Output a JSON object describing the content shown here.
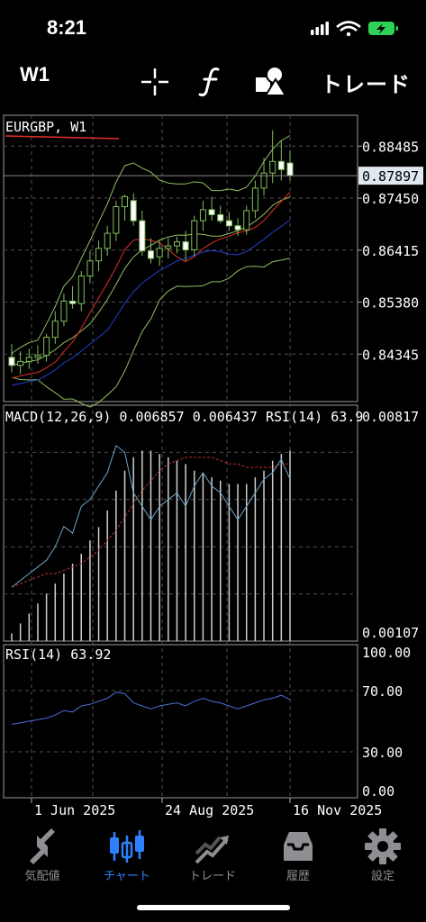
{
  "status": {
    "time": "8:21"
  },
  "toolbar": {
    "timeframe": "W1",
    "trade_label": "トレード"
  },
  "chart": {
    "symbol_label": "EURGBP, W1",
    "price_axis": [
      "0.88485",
      "0.87450",
      "0.86415",
      "0.85380",
      "0.84345"
    ],
    "current_price": "0.87897",
    "macd_label": "MACD(12,26,9) 0.006857 0.006437 RSI(14) 63.9",
    "macd_axis_top": "0.00817",
    "macd_axis_bottom": "0.00107",
    "rsi_label": "RSI(14) 63.92",
    "rsi_axis": [
      "100.00",
      "70.00",
      "30.00",
      "0.00"
    ],
    "time_axis": [
      "1 Jun 2025",
      "24 Aug 2025",
      "16 Nov 2025"
    ]
  },
  "chart_data": {
    "type": "candlestick",
    "symbol": "EURGBP",
    "timeframe": "W1",
    "current_price": 0.87897,
    "price_ylim": [
      0.834,
      0.891
    ],
    "price_ticks": [
      0.88485,
      0.8745,
      0.86415,
      0.8538,
      0.84345
    ],
    "x_labels": [
      "1 Jun 2025",
      "24 Aug 2025",
      "16 Nov 2025"
    ],
    "candles": [
      {
        "o": 0.8428,
        "h": 0.8455,
        "l": 0.8398,
        "c": 0.8412
      },
      {
        "o": 0.8412,
        "h": 0.844,
        "l": 0.8395,
        "c": 0.842
      },
      {
        "o": 0.842,
        "h": 0.8445,
        "l": 0.8405,
        "c": 0.8428
      },
      {
        "o": 0.8428,
        "h": 0.8452,
        "l": 0.8415,
        "c": 0.8432
      },
      {
        "o": 0.8432,
        "h": 0.8475,
        "l": 0.842,
        "c": 0.8468
      },
      {
        "o": 0.8468,
        "h": 0.852,
        "l": 0.8455,
        "c": 0.85
      },
      {
        "o": 0.85,
        "h": 0.8555,
        "l": 0.849,
        "c": 0.854
      },
      {
        "o": 0.854,
        "h": 0.857,
        "l": 0.8525,
        "c": 0.8535
      },
      {
        "o": 0.8535,
        "h": 0.86,
        "l": 0.852,
        "c": 0.859
      },
      {
        "o": 0.859,
        "h": 0.864,
        "l": 0.8575,
        "c": 0.862
      },
      {
        "o": 0.862,
        "h": 0.866,
        "l": 0.86,
        "c": 0.8645
      },
      {
        "o": 0.8645,
        "h": 0.869,
        "l": 0.863,
        "c": 0.8675
      },
      {
        "o": 0.8675,
        "h": 0.874,
        "l": 0.866,
        "c": 0.8728
      },
      {
        "o": 0.8728,
        "h": 0.8752,
        "l": 0.87,
        "c": 0.8748
      },
      {
        "o": 0.874,
        "h": 0.8755,
        "l": 0.869,
        "c": 0.87
      },
      {
        "o": 0.87,
        "h": 0.872,
        "l": 0.863,
        "c": 0.864
      },
      {
        "o": 0.864,
        "h": 0.8665,
        "l": 0.8615,
        "c": 0.8625
      },
      {
        "o": 0.8628,
        "h": 0.866,
        "l": 0.861,
        "c": 0.8645
      },
      {
        "o": 0.8645,
        "h": 0.8665,
        "l": 0.8625,
        "c": 0.865
      },
      {
        "o": 0.865,
        "h": 0.8668,
        "l": 0.8635,
        "c": 0.8658
      },
      {
        "o": 0.8658,
        "h": 0.868,
        "l": 0.862,
        "c": 0.8642
      },
      {
        "o": 0.8642,
        "h": 0.871,
        "l": 0.863,
        "c": 0.87
      },
      {
        "o": 0.87,
        "h": 0.874,
        "l": 0.868,
        "c": 0.8722
      },
      {
        "o": 0.8722,
        "h": 0.8748,
        "l": 0.87,
        "c": 0.8712
      },
      {
        "o": 0.8712,
        "h": 0.873,
        "l": 0.8695,
        "c": 0.87
      },
      {
        "o": 0.87,
        "h": 0.8718,
        "l": 0.868,
        "c": 0.869
      },
      {
        "o": 0.869,
        "h": 0.8705,
        "l": 0.867,
        "c": 0.8682
      },
      {
        "o": 0.8682,
        "h": 0.873,
        "l": 0.8672,
        "c": 0.872
      },
      {
        "o": 0.872,
        "h": 0.878,
        "l": 0.8705,
        "c": 0.8765
      },
      {
        "o": 0.8765,
        "h": 0.8825,
        "l": 0.875,
        "c": 0.8795
      },
      {
        "o": 0.8795,
        "h": 0.888,
        "l": 0.8775,
        "c": 0.8818
      },
      {
        "o": 0.8818,
        "h": 0.886,
        "l": 0.878,
        "c": 0.8802
      },
      {
        "o": 0.8815,
        "h": 0.884,
        "l": 0.878,
        "c": 0.879
      }
    ],
    "macd": {
      "ylim": [
        0.00107,
        0.00817
      ],
      "values": [
        0.0013,
        0.0016,
        0.0019,
        0.0022,
        0.0025,
        0.0028,
        0.0031,
        0.0034,
        0.0037,
        0.0041,
        0.0045,
        0.005,
        0.0056,
        0.0062,
        0.0066,
        0.0068,
        0.0068,
        0.0067,
        0.0066,
        0.0065,
        0.0064,
        0.0062,
        0.0061,
        0.006,
        0.0059,
        0.0058,
        0.0058,
        0.0058,
        0.006,
        0.0062,
        0.0065,
        0.0067,
        0.0068
      ],
      "signal": [
        0.0027,
        0.0028,
        0.0029,
        0.003,
        0.0031,
        0.0031,
        0.0032,
        0.0033,
        0.0034,
        0.0036,
        0.0038,
        0.0041,
        0.0044,
        0.0048,
        0.0052,
        0.0056,
        0.0059,
        0.0062,
        0.0064,
        0.0065,
        0.0066,
        0.0066,
        0.0066,
        0.0066,
        0.0065,
        0.0064,
        0.0064,
        0.0063,
        0.0063,
        0.0063,
        0.0063,
        0.0064,
        0.0064
      ],
      "last": 0.006857,
      "signal_last": 0.006437
    },
    "rsi": {
      "ylim": [
        0,
        100
      ],
      "levels": [
        70,
        30
      ],
      "values": [
        48,
        49,
        50,
        51,
        52,
        54,
        57,
        56,
        60,
        61,
        63,
        65,
        69,
        68,
        62,
        60,
        58,
        60,
        61,
        62,
        60,
        63,
        65,
        63,
        62,
        60,
        58,
        60,
        62,
        64,
        65,
        67,
        64
      ],
      "last": 63.92
    }
  },
  "tabbar": {
    "items": [
      {
        "label": "気配値",
        "icon": "quotes-arrows-icon"
      },
      {
        "label": "チャート",
        "icon": "candlestick-chart-icon"
      },
      {
        "label": "トレード",
        "icon": "trade-trend-icon"
      },
      {
        "label": "履歴",
        "icon": "history-inbox-icon"
      },
      {
        "label": "設定",
        "icon": "settings-gear-icon"
      }
    ],
    "active_index": 1
  },
  "colors": {
    "active": "#2f80ff",
    "inactive": "#8e8e93",
    "bull_candle": "#ffffff",
    "bear_candle": "#ffffff",
    "ma_red": "#e0302a",
    "ma_blue": "#2040d0",
    "bollinger": "#8fbf60",
    "macd_signal": "#c03030",
    "rsi_line": "#4a6fd8",
    "grid": "#505050"
  }
}
